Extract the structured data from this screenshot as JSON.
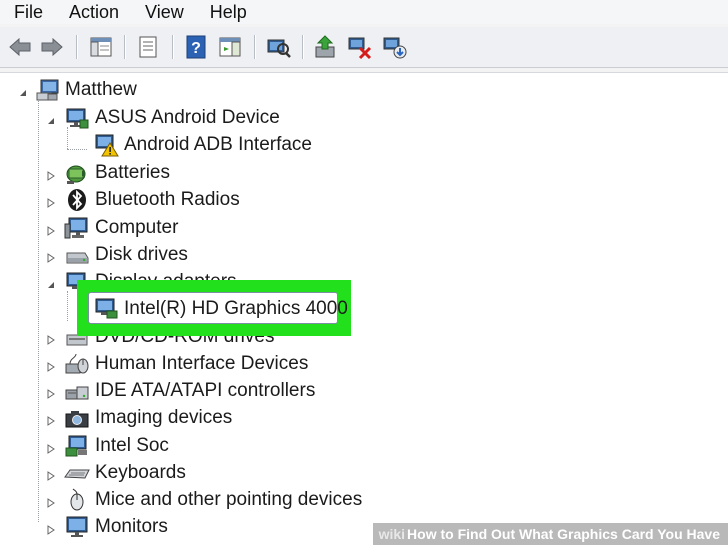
{
  "menu": [
    "File",
    "Action",
    "View",
    "Help"
  ],
  "toolbar": {
    "buttons": [
      "back-arrow-icon",
      "forward-arrow-icon",
      "show-hide-tree-icon",
      "properties-icon",
      "help-icon",
      "action-pane-icon",
      "scan-hardware-icon",
      "update-driver-icon",
      "disable-device-icon",
      "uninstall-device-icon"
    ]
  },
  "tree": {
    "root": "Matthew",
    "items": [
      {
        "label": "ASUS Android Device",
        "expanded": true,
        "icon": "android-device-icon"
      },
      {
        "label": "Android ADB Interface",
        "child": true,
        "icon": "adb-warning-icon"
      },
      {
        "label": "Batteries",
        "icon": "battery-icon"
      },
      {
        "label": "Bluetooth Radios",
        "icon": "bluetooth-icon"
      },
      {
        "label": "Computer",
        "icon": "computer-icon"
      },
      {
        "label": "Disk drives",
        "icon": "disk-drive-icon"
      },
      {
        "label": "Display adapters",
        "expanded": true,
        "icon": "display-adapter-icon"
      },
      {
        "label": "Intel(R) HD Graphics 4000",
        "child": true,
        "selected": true,
        "icon": "display-adapter-icon"
      },
      {
        "label": "DVD/CD-ROM drives",
        "icon": "dvd-drive-icon"
      },
      {
        "label": "Human Interface Devices",
        "icon": "hid-icon"
      },
      {
        "label": "IDE ATA/ATAPI controllers",
        "icon": "ide-controller-icon"
      },
      {
        "label": "Imaging devices",
        "icon": "camera-icon"
      },
      {
        "label": "Intel Soc",
        "icon": "intel-soc-icon"
      },
      {
        "label": "Keyboards",
        "icon": "keyboard-icon"
      },
      {
        "label": "Mice and other pointing devices",
        "icon": "mouse-icon"
      },
      {
        "label": "Monitors",
        "icon": "monitor-icon"
      }
    ]
  },
  "watermark": {
    "brand": "wiki",
    "text": "How to Find Out What Graphics Card You Have"
  },
  "colors": {
    "highlight": "#22e01c",
    "selection_border": "#7c8ea3"
  }
}
